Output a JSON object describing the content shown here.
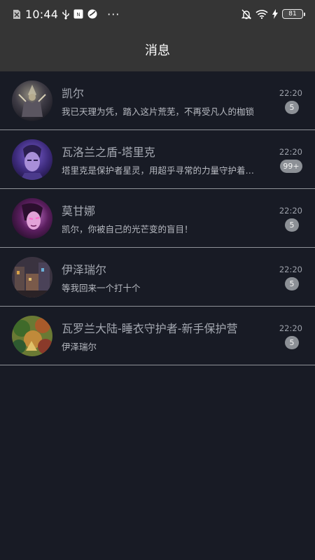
{
  "status_bar": {
    "time": "10:44",
    "battery": "81",
    "icons": [
      "sim-off-icon",
      "usb-icon",
      "nfc-icon",
      "browser-icon",
      "more-dots-icon",
      "silent-icon",
      "wifi-icon",
      "charging-icon",
      "battery-icon"
    ],
    "dots": "···"
  },
  "header": {
    "title": "消息"
  },
  "conversations": [
    {
      "name": "凯尔",
      "preview": "我已天理为凭，踏入这片荒芜，不再受凡人的枷锁",
      "time": "22:20",
      "badge": "5",
      "avatar": "warrior-avatar"
    },
    {
      "name": "瓦洛兰之盾-塔里克",
      "preview": "塔里克是保护者星灵，用超乎寻常的力量守护着符文之地",
      "time": "22:20",
      "badge": "99+",
      "avatar": "purple-hero-avatar"
    },
    {
      "name": "莫甘娜",
      "preview": "凯尔，你被自己的光芒变的盲目！",
      "time": "22:20",
      "badge": "5",
      "avatar": "dark-angel-avatar"
    },
    {
      "name": "伊泽瑞尔",
      "preview": "等我回来一个打十个",
      "time": "22:20",
      "badge": "5",
      "avatar": "city-avatar"
    },
    {
      "name": "瓦罗兰大陆-睡衣守护者-新手保护营",
      "preview": "伊泽瑞尔",
      "time": "22:20",
      "badge": "5",
      "avatar": "forest-avatar"
    }
  ],
  "colors": {
    "background": "#181b25",
    "bar": "#353535",
    "badge": "#8c9096",
    "divider": "#8f9298"
  }
}
